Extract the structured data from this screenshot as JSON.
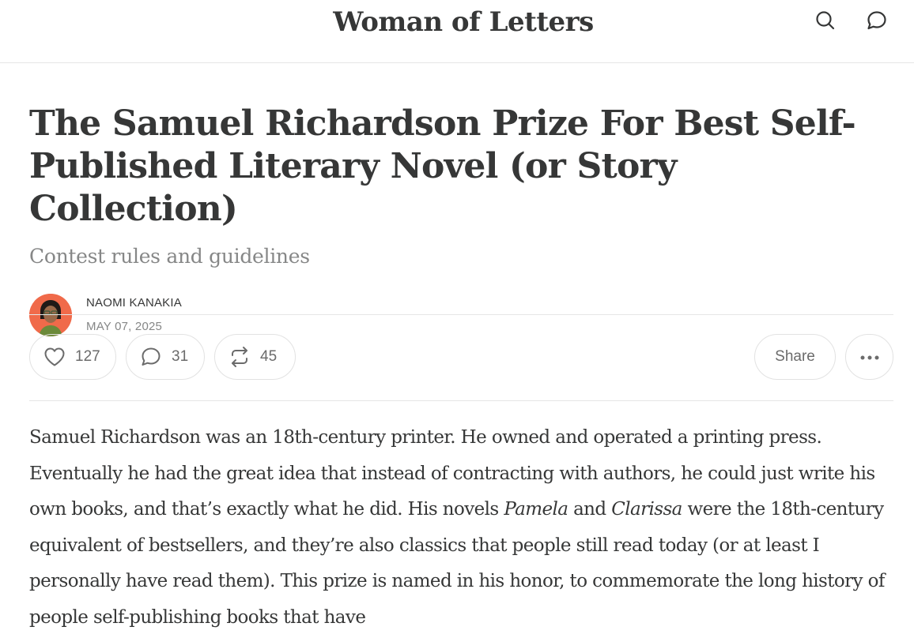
{
  "header": {
    "publication": "Woman of Letters",
    "icons": [
      "search-icon",
      "chat-icon"
    ]
  },
  "post": {
    "title": "The Samuel Richardson Prize For Best Self-Published Literary Novel (or Story Collection)",
    "subtitle": "Contest rules and guidelines",
    "author": "NAOMI KANAKIA",
    "date": "MAY 07, 2025"
  },
  "actions": {
    "likes": "127",
    "comments": "31",
    "restacks": "45",
    "share_label": "Share",
    "more_label": "···"
  },
  "body": {
    "p1_a": "Samuel Richardson was an 18th-century printer. He owned and operated a printing press. Eventually he had the great idea that instead of contracting with authors, he could just write his own books, and that’s exactly what he did. His novels ",
    "p1_em1": "Pamela",
    "p1_b": " and ",
    "p1_em2": "Clarissa",
    "p1_c": " were the 18th-century equivalent of bestsellers, and they’re also classics that people still read today (or at least I personally have read them). This prize is named in his honor, to commemorate the long history of people self-publishing books that have"
  },
  "colors": {
    "text": "#363737",
    "muted": "#868787",
    "border": "#e6e6e6",
    "avatar_bg": "#f06a4a"
  }
}
